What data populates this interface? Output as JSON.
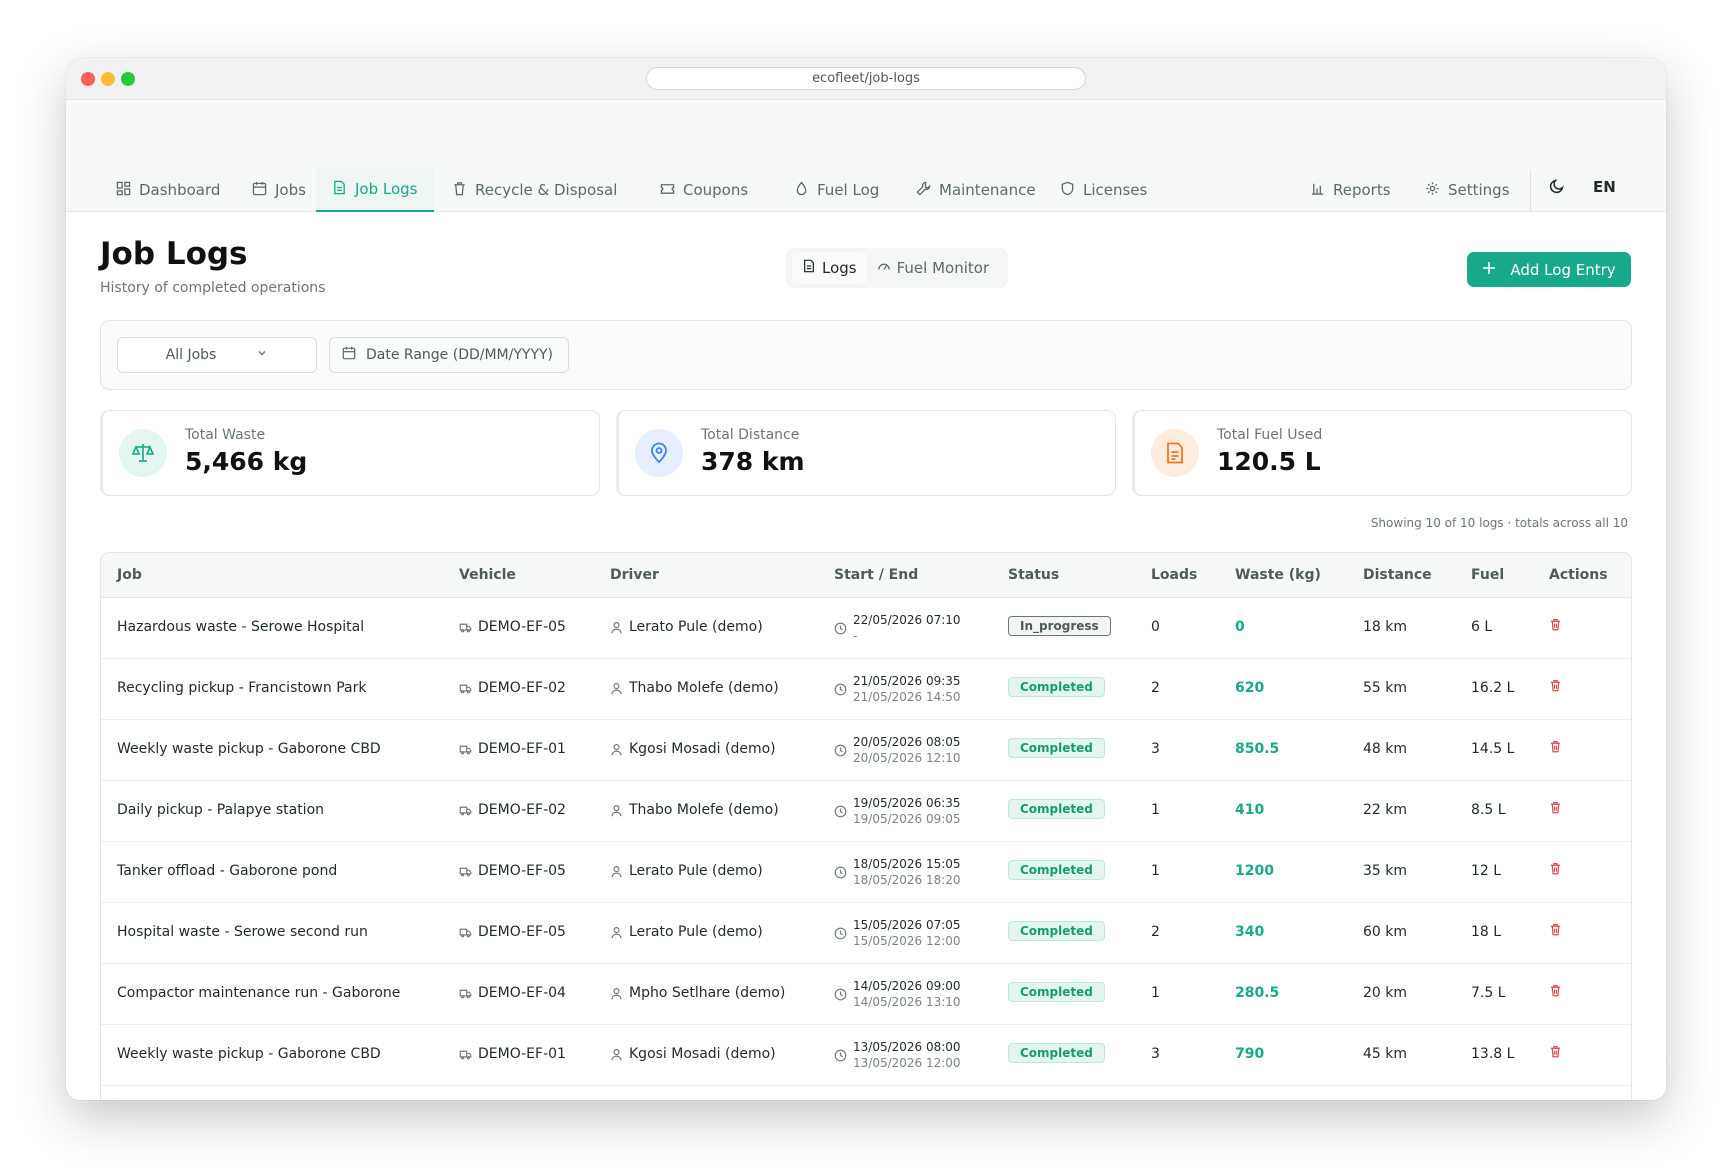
{
  "browser": {
    "url": "ecofleet/job-logs"
  },
  "nav": {
    "items": [
      {
        "label": "Dashboard",
        "icon": "dashboard-icon"
      },
      {
        "label": "Jobs",
        "icon": "calendar-icon"
      },
      {
        "label": "Job Logs",
        "icon": "document-icon",
        "active": true
      },
      {
        "label": "Recycle & Disposal",
        "icon": "trash-icon"
      },
      {
        "label": "Coupons",
        "icon": "ticket-icon"
      },
      {
        "label": "Fuel Log",
        "icon": "droplet-icon"
      },
      {
        "label": "Maintenance",
        "icon": "wrench-icon"
      },
      {
        "label": "Licenses",
        "icon": "shield-icon"
      }
    ],
    "right_items": [
      {
        "label": "Reports",
        "icon": "bar-chart-icon"
      },
      {
        "label": "Settings",
        "icon": "gear-icon"
      }
    ],
    "language": "EN"
  },
  "header": {
    "title": "Job Logs",
    "subtitle": "History of completed operations",
    "tabs": [
      {
        "label": "Logs",
        "active": true
      },
      {
        "label": "Fuel Monitor",
        "active": false
      }
    ],
    "add_button": "Add Log Entry"
  },
  "filters": {
    "job_select": "All Jobs",
    "date_range_placeholder": "Date Range (DD/MM/YYYY)"
  },
  "stats": [
    {
      "label": "Total Waste",
      "value": "5,466 kg",
      "color": "#17a98a"
    },
    {
      "label": "Total Distance",
      "value": "378 km",
      "color": "#3b82f6"
    },
    {
      "label": "Total Fuel Used",
      "value": "120.5 L",
      "color": "#f97316"
    }
  ],
  "showing_text": "Showing 10 of 10 logs · totals across all 10",
  "table": {
    "columns": [
      "Job",
      "Vehicle",
      "Driver",
      "Start / End",
      "Status",
      "Loads",
      "Waste (kg)",
      "Distance",
      "Fuel",
      "Actions"
    ],
    "rows": [
      {
        "job": "Hazardous waste - Serowe Hospital",
        "vehicle": "DEMO-EF-05",
        "driver": "Lerato Pule (demo)",
        "start": "22/05/2026 07:10",
        "end": "-",
        "status": "In_progress",
        "loads": "0",
        "waste": "0",
        "distance": "18 km",
        "fuel": "6 L"
      },
      {
        "job": "Recycling pickup - Francistown Park",
        "vehicle": "DEMO-EF-02",
        "driver": "Thabo Molefe (demo)",
        "start": "21/05/2026 09:35",
        "end": "21/05/2026 14:50",
        "status": "Completed",
        "loads": "2",
        "waste": "620",
        "distance": "55 km",
        "fuel": "16.2 L"
      },
      {
        "job": "Weekly waste pickup - Gaborone CBD",
        "vehicle": "DEMO-EF-01",
        "driver": "Kgosi Mosadi (demo)",
        "start": "20/05/2026 08:05",
        "end": "20/05/2026 12:10",
        "status": "Completed",
        "loads": "3",
        "waste": "850.5",
        "distance": "48 km",
        "fuel": "14.5 L"
      },
      {
        "job": "Daily pickup - Palapye station",
        "vehicle": "DEMO-EF-02",
        "driver": "Thabo Molefe (demo)",
        "start": "19/05/2026 06:35",
        "end": "19/05/2026 09:05",
        "status": "Completed",
        "loads": "1",
        "waste": "410",
        "distance": "22 km",
        "fuel": "8.5 L"
      },
      {
        "job": "Tanker offload - Gaborone pond",
        "vehicle": "DEMO-EF-05",
        "driver": "Lerato Pule (demo)",
        "start": "18/05/2026 15:05",
        "end": "18/05/2026 18:20",
        "status": "Completed",
        "loads": "1",
        "waste": "1200",
        "distance": "35 km",
        "fuel": "12 L"
      },
      {
        "job": "Hospital waste - Serowe second run",
        "vehicle": "DEMO-EF-05",
        "driver": "Lerato Pule (demo)",
        "start": "15/05/2026 07:05",
        "end": "15/05/2026 12:00",
        "status": "Completed",
        "loads": "2",
        "waste": "340",
        "distance": "60 km",
        "fuel": "18 L"
      },
      {
        "job": "Compactor maintenance run - Gaborone",
        "vehicle": "DEMO-EF-04",
        "driver": "Mpho Setlhare (demo)",
        "start": "14/05/2026 09:00",
        "end": "14/05/2026 13:10",
        "status": "Completed",
        "loads": "1",
        "waste": "280.5",
        "distance": "20 km",
        "fuel": "7.5 L"
      },
      {
        "job": "Weekly waste pickup - Gaborone CBD",
        "vehicle": "DEMO-EF-01",
        "driver": "Kgosi Mosadi (demo)",
        "start": "13/05/2026 08:00",
        "end": "13/05/2026 12:00",
        "status": "Completed",
        "loads": "3",
        "waste": "790",
        "distance": "45 km",
        "fuel": "13.8 L"
      }
    ]
  },
  "colors": {
    "accent": "#17a98a",
    "danger": "#e5484d"
  }
}
